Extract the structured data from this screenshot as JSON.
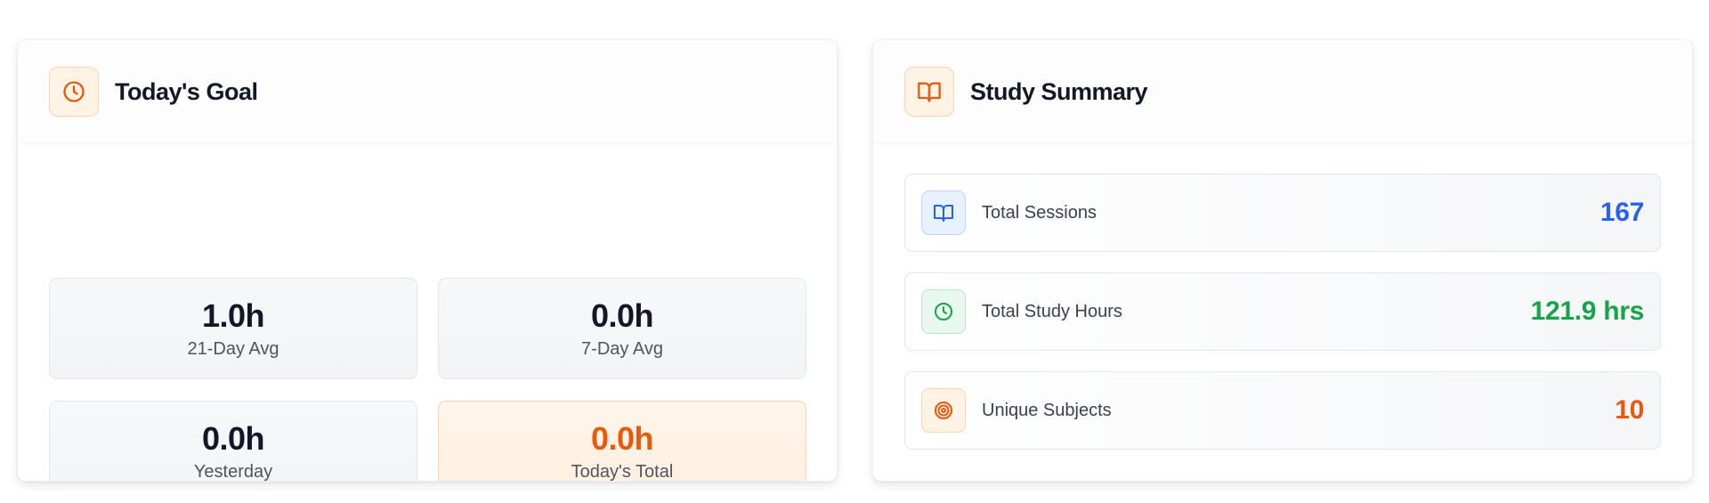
{
  "goal": {
    "title": "Today's Goal",
    "icon": "clock-icon",
    "stats": [
      {
        "value": "1.0h",
        "label": "21-Day Avg"
      },
      {
        "value": "0.0h",
        "label": "7-Day Avg"
      },
      {
        "value": "0.0h",
        "label": "Yesterday"
      },
      {
        "value": "0.0h",
        "label": "Today's Total"
      }
    ]
  },
  "summary": {
    "title": "Study Summary",
    "icon": "book-icon",
    "rows": [
      {
        "icon": "book-icon",
        "label": "Total Sessions",
        "value": "167",
        "color": "#2563eb"
      },
      {
        "icon": "clock-icon",
        "label": "Total Study Hours",
        "value": "121.9 hrs",
        "color": "#16a34a"
      },
      {
        "icon": "target-icon",
        "label": "Unique Subjects",
        "value": "10",
        "color": "#ea580c"
      }
    ]
  },
  "colors": {
    "accent": "#ea580c",
    "accent_bg": "#fff3e6",
    "text": "#111827",
    "muted": "#4b5563"
  }
}
